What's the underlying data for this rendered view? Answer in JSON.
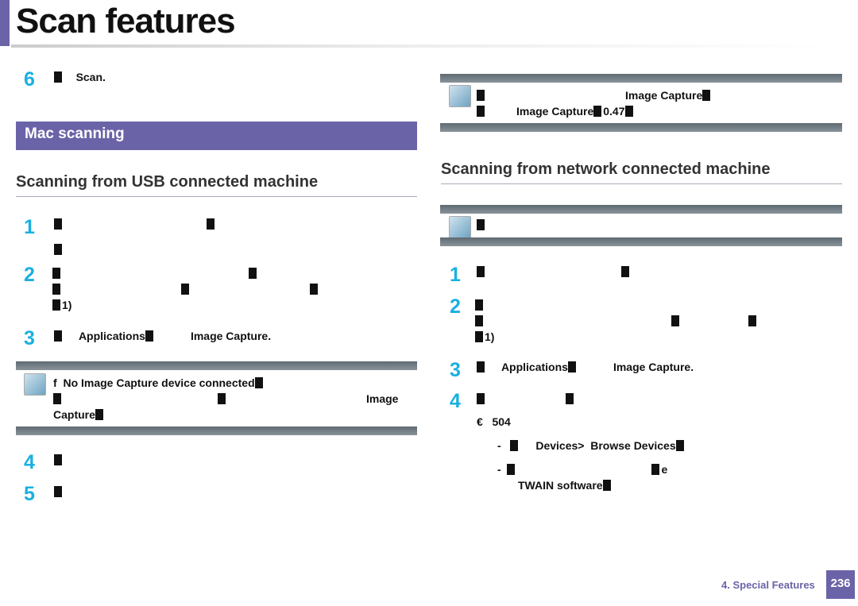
{
  "header": {
    "title": "Scan features"
  },
  "left": {
    "step6": {
      "num": "6",
      "text": "Scan."
    },
    "section_band": "Mac scanning",
    "heading": "Scanning from USB connected machine",
    "steps": [
      {
        "num": "1"
      },
      {
        "num": "2",
        "suffix": "1)"
      },
      {
        "num": "3",
        "app": "Applications",
        "bold": "Image Capture."
      },
      {
        "num": "4"
      },
      {
        "num": "5"
      }
    ],
    "note": {
      "line1": "No Image Capture device connected",
      "line1_prefix": "f",
      "line2_end": "Image",
      "line3": "Capture"
    }
  },
  "right": {
    "note1": {
      "line1": "Image Capture",
      "line2": "Image Capture",
      "line2_num": "0.47"
    },
    "heading": "Scanning from network connected machine",
    "steps": [
      {
        "num": "1"
      },
      {
        "num": "2",
        "suffix": "1)"
      },
      {
        "num": "3",
        "app": "Applications",
        "bold": "Image Capture."
      },
      {
        "num": "4",
        "sub": "€",
        "subnum": "504",
        "b1a": "Devices>",
        "b1b": "Browse Devices",
        "b2tail": "e",
        "b2line": "TWAIN software",
        "dash": "-"
      }
    ]
  },
  "footer": {
    "chapter": "4.  Special Features",
    "page": "236"
  },
  "colors": {
    "accent": "#6b63a8",
    "step_number": "#1ab0e0"
  }
}
